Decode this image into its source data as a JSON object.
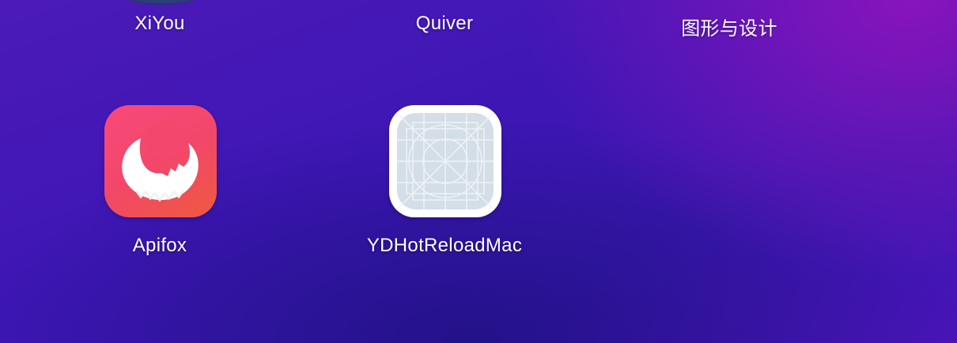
{
  "apps": {
    "top_row": [
      {
        "name": "XiYou",
        "icon": "xiyou-app-icon"
      },
      {
        "name": "Quiver",
        "icon": "quiver-app-icon"
      },
      {
        "name": "图形与设计",
        "icon": "folder-icon"
      }
    ],
    "bottom_row": [
      {
        "name": "Apifox",
        "icon": "apifox-app-icon",
        "accent": "#f2476a"
      },
      {
        "name": "YDHotReloadMac",
        "icon": "generic-app-icon",
        "accent": "#d3dee6"
      }
    ]
  }
}
